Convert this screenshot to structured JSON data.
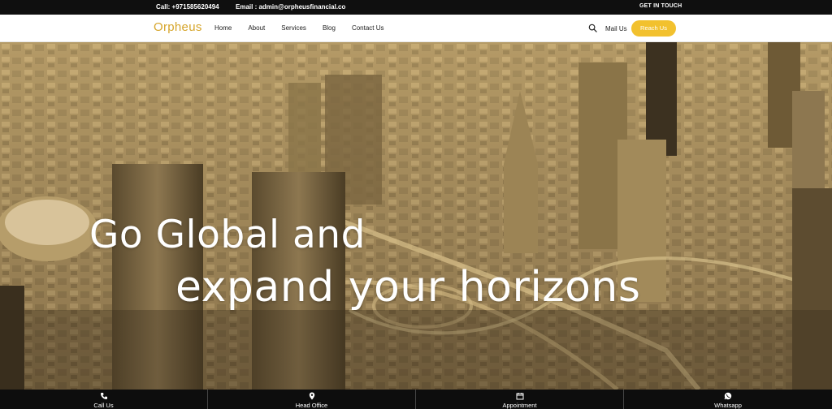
{
  "topbar": {
    "call": "Call: +971585620494",
    "email": "Email : admin@orpheusfinancial.co",
    "get_in_touch": "GET IN TOUCH"
  },
  "navbar": {
    "logo": "Orpheus",
    "links": [
      "Home",
      "About",
      "Services",
      "Blog",
      "Contact Us"
    ],
    "mail_us": "Mail Us",
    "reach_us": "Reach Us",
    "accent_color": "#f2c12e"
  },
  "hero": {
    "line1": "Go Global and",
    "line2": "expand your horizons"
  },
  "bottombar": {
    "items": [
      {
        "label": "Call Us",
        "icon": "phone-icon"
      },
      {
        "label": "Head Office",
        "icon": "location-pin-icon"
      },
      {
        "label": "Appointment",
        "icon": "calendar-icon"
      },
      {
        "label": "Whatsapp",
        "icon": "whatsapp-icon"
      }
    ]
  }
}
